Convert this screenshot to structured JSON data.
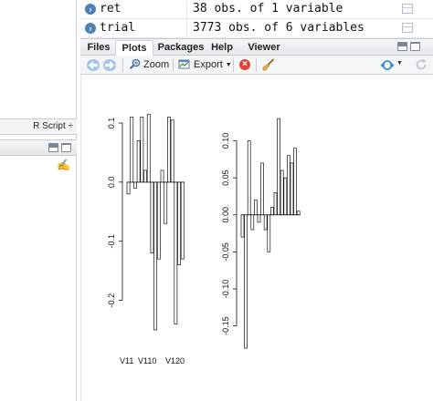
{
  "environment": {
    "rows": [
      {
        "name": "ret",
        "description": "38 obs. of 1 variable"
      },
      {
        "name": "trial",
        "description": "3773 obs. of 6 variables"
      }
    ]
  },
  "left_pane": {
    "script_type": "R Script ÷"
  },
  "tabs": [
    {
      "label": "Files"
    },
    {
      "label": "Plots"
    },
    {
      "label": "Packages"
    },
    {
      "label": "Help"
    },
    {
      "label": "Viewer"
    }
  ],
  "active_tab": "Plots",
  "toolbar": {
    "zoom_label": "Zoom",
    "export_label": "Export"
  },
  "colors": {
    "info_icon": "#4e7fb7",
    "remove_icon": "#e04334",
    "nav_arrow": "#a9c4e4"
  },
  "chart_data": [
    {
      "type": "bar",
      "orientation": "vertical",
      "grid": false,
      "ylim": [
        -0.25,
        0.12
      ],
      "yticks": [
        0.1,
        0.0,
        -0.1,
        -0.2
      ],
      "ytick_labels": [
        "0.1",
        "0.0",
        "-0.1",
        "-0.2"
      ],
      "x_tick_labels": [
        "V11",
        "V110",
        "V120"
      ],
      "values": [
        -0.02,
        0.11,
        -0.01,
        0.07,
        0.11,
        0.02,
        0.115,
        -0.12,
        -0.25,
        -0.13,
        0.02,
        -0.07,
        0.11,
        0.105,
        -0.24,
        -0.14,
        -0.13
      ]
    },
    {
      "type": "bar",
      "orientation": "vertical",
      "grid": false,
      "ylim": [
        -0.18,
        0.14
      ],
      "yticks": [
        0.1,
        0.05,
        0.0,
        -0.05,
        -0.1,
        -0.15
      ],
      "ytick_labels": [
        "0.10",
        "0.05",
        "0.00",
        "-0.05",
        "-0.10",
        "-0.15"
      ],
      "values": [
        -0.03,
        -0.18,
        0.1,
        -0.02,
        0.02,
        -0.01,
        0.07,
        -0.02,
        -0.05,
        0.01,
        0.03,
        0.13,
        0.06,
        0.05,
        0.08,
        0.07,
        0.09,
        0.005
      ]
    }
  ]
}
